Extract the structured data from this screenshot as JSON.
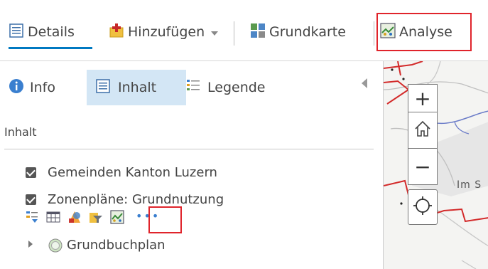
{
  "toolbar": {
    "details_label": "Details",
    "add_label": "Hinzufügen",
    "basemap_label": "Grundkarte",
    "analysis_label": "Analyse"
  },
  "panel": {
    "tabs": [
      {
        "label": "Info",
        "icon": "info-icon",
        "selected": false
      },
      {
        "label": "Inhalt",
        "icon": "content-list-icon",
        "selected": true
      },
      {
        "label": "Legende",
        "icon": "legend-icon",
        "selected": false
      }
    ],
    "section_title": "Inhalt",
    "layers": [
      {
        "label": "Gemeinden Kanton Luzern",
        "checked": true
      },
      {
        "label": "Zonenpläne: Grundnutzung",
        "checked": true
      },
      {
        "label": "Grundbuchplan",
        "icon": "basemap-globe-icon",
        "expandable": true
      }
    ],
    "layer_tools": [
      "show-table-icon",
      "attribute-table-icon",
      "change-style-icon",
      "filter-icon",
      "perform-analysis-icon",
      "more-options-icon"
    ],
    "more_label": "•••"
  },
  "map": {
    "label_text": "Im S",
    "zoom_in": "+",
    "zoom_out": "−"
  },
  "colors": {
    "accent": "#0079c1",
    "highlight": "#e0242b",
    "selected_tab_bg": "#d3e6f5",
    "boundary_red": "#d32a2a"
  }
}
